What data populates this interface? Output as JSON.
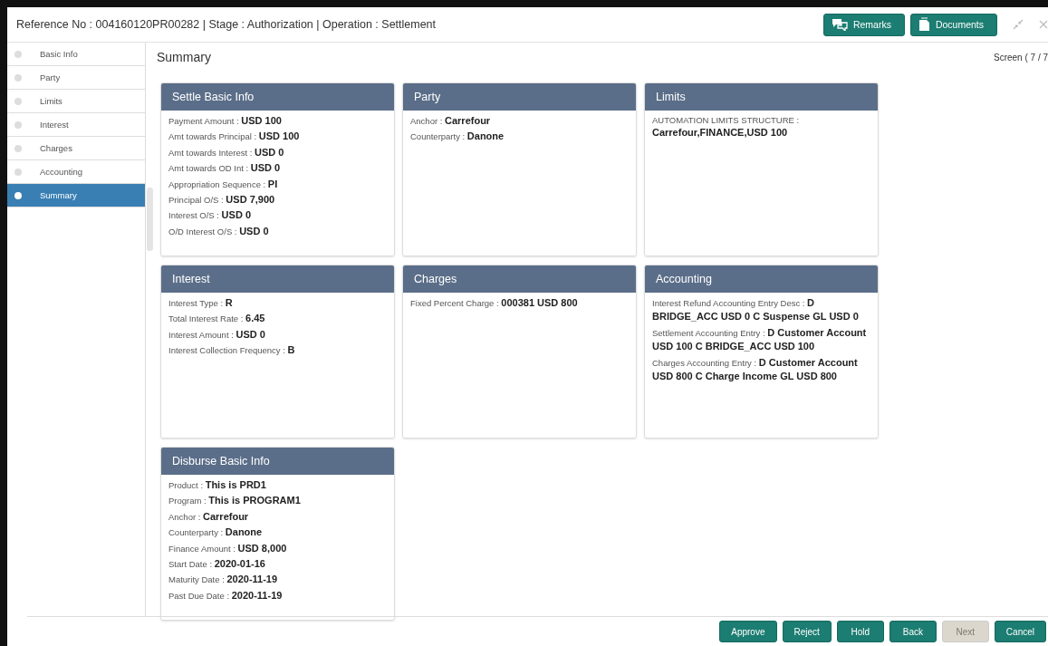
{
  "header": {
    "title": "Reference No : 004160120PR00282 | Stage : Authorization | Operation : Settlement",
    "buttons": [
      {
        "label": "Remarks",
        "kind": "remarks"
      },
      {
        "label": "Documents",
        "kind": "documents"
      }
    ]
  },
  "sidebar": {
    "items": [
      {
        "label": "Basic Info",
        "selected": false
      },
      {
        "label": "Party",
        "selected": false
      },
      {
        "label": "Limits",
        "selected": false
      },
      {
        "label": "Interest",
        "selected": false
      },
      {
        "label": "Charges",
        "selected": false
      },
      {
        "label": "Accounting",
        "selected": false
      },
      {
        "label": "Summary",
        "selected": true
      }
    ]
  },
  "page": {
    "title": "Summary",
    "screen_counter": "Screen ( 7 / 7"
  },
  "cards": [
    {
      "title": "Settle Basic Info",
      "fields": [
        {
          "label": "Payment Amount :",
          "value": "USD 100"
        },
        {
          "label": "Amt towards Principal :",
          "value": "USD 100"
        },
        {
          "label": "Amt towards Interest :",
          "value": "USD 0"
        },
        {
          "label": "Amt towards OD Int :",
          "value": "USD 0"
        },
        {
          "label": "Appropriation Sequence :",
          "value": "PI"
        },
        {
          "label": "Principal O/S :",
          "value": "USD 7,900"
        },
        {
          "label": "Interest O/S :",
          "value": "USD 0"
        },
        {
          "label": "O/D Interest O/S :",
          "value": "USD 0"
        }
      ]
    },
    {
      "title": "Party",
      "fields": [
        {
          "label": "Anchor :",
          "value": "Carrefour"
        },
        {
          "label": "Counterparty :",
          "value": "Danone"
        }
      ]
    },
    {
      "title": "Limits",
      "fields": [
        {
          "label": "AUTOMATION LIMITS STRUCTURE :",
          "value": "Carrefour,FINANCE,USD 100"
        }
      ]
    },
    {
      "title": "Interest",
      "fields": [
        {
          "label": "Interest Type :",
          "value": "R"
        },
        {
          "label": "Total Interest Rate :",
          "value": "6.45"
        },
        {
          "label": "Interest Amount :",
          "value": "USD 0"
        },
        {
          "label": "Interest Collection Frequency :",
          "value": "B"
        }
      ]
    },
    {
      "title": "Charges",
      "fields": [
        {
          "label": "Fixed Percent Charge :",
          "value": "000381 USD 800"
        }
      ]
    },
    {
      "title": "Accounting",
      "fields": [
        {
          "label": "Interest Refund Accounting Entry Desc :",
          "value": "D BRIDGE_ACC USD 0 C Suspense GL USD 0"
        },
        {
          "label": "Settlement Accounting Entry :",
          "value": "D Customer Account USD 100 C BRIDGE_ACC USD 100"
        },
        {
          "label": "Charges Accounting Entry :",
          "value": "D Customer Account USD 800 C Charge Income GL USD 800"
        }
      ]
    },
    {
      "title": "Disburse Basic Info",
      "fields": [
        {
          "label": "Product :",
          "value": "This is PRD1"
        },
        {
          "label": "Program :",
          "value": "This is PROGRAM1"
        },
        {
          "label": "Anchor :",
          "value": "Carrefour"
        },
        {
          "label": "Counterparty :",
          "value": "Danone"
        },
        {
          "label": "Finance Amount :",
          "value": "USD 8,000"
        },
        {
          "label": "Start Date :",
          "value": "2020-01-16"
        },
        {
          "label": "Maturity Date :",
          "value": "2020-11-19"
        },
        {
          "label": "Past Due Date :",
          "value": "2020-11-19"
        }
      ]
    }
  ],
  "footer": {
    "buttons": [
      {
        "label": "Approve",
        "disabled": false
      },
      {
        "label": "Reject",
        "disabled": false
      },
      {
        "label": "Hold",
        "disabled": false
      },
      {
        "label": "Back",
        "disabled": false
      },
      {
        "label": "Next",
        "disabled": true
      },
      {
        "label": "Cancel",
        "disabled": false
      }
    ]
  }
}
